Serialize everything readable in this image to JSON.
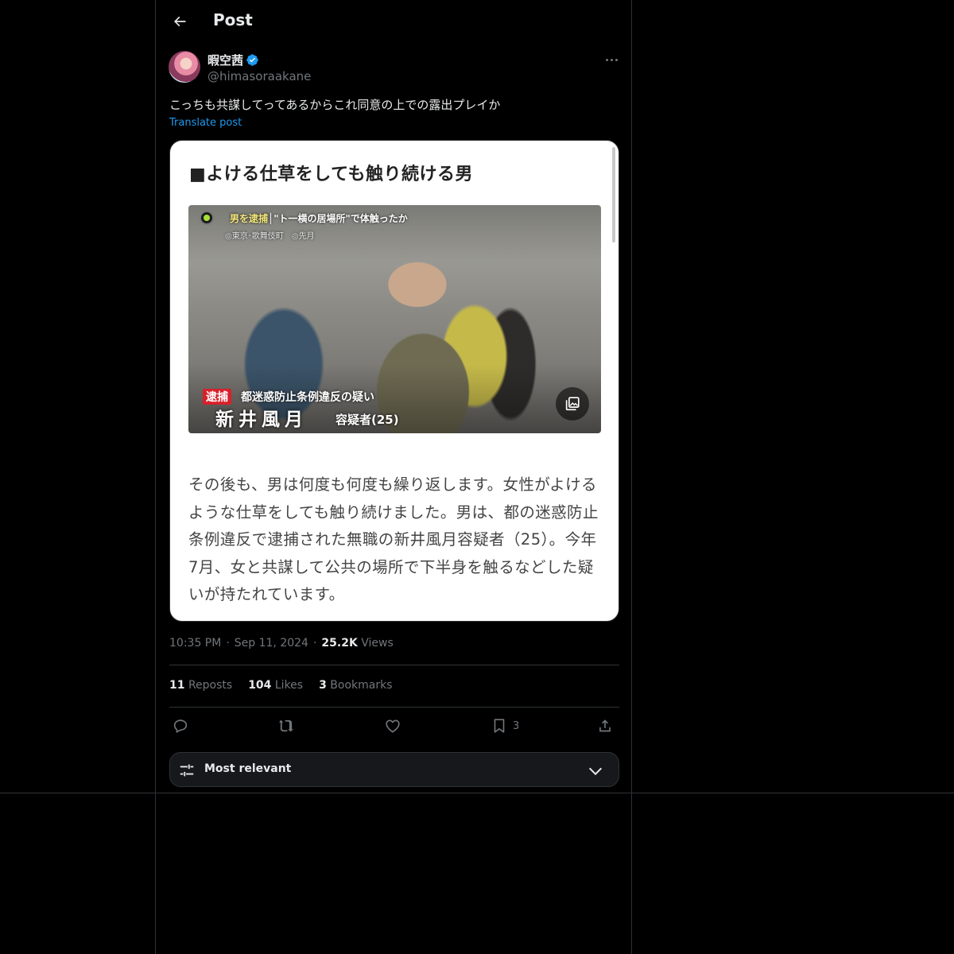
{
  "header": {
    "title": "Post"
  },
  "author": {
    "display_name": "暇空茜",
    "handle": "@himasoraakane",
    "verified": true
  },
  "post": {
    "text": "こっちも共謀してってあるからこれ同意の上での露出プレイか",
    "translate_label": "Translate post",
    "time": "10:35 PM",
    "date": "Sep 11, 2024",
    "views_count": "25.2K",
    "views_label": "Views",
    "separator": "·"
  },
  "media": {
    "heading": "■よける仕草をしても触り続ける男",
    "photo": {
      "caption_tag": "男を逮捕",
      "caption_top": "│\"ト一横の居場所\"で体触ったか",
      "caption_sub": "◎東京･歌舞伎町　◎先月",
      "arrest_badge": "逮捕",
      "arrest_charge": "都迷惑防止条例違反の疑い",
      "suspect_name": "新井風月",
      "suspect_title": "容疑者(25)"
    },
    "body": "その後も、男は何度も何度も繰り返します。女性がよけるような仕草をしても触り続けました。男は、都の迷惑防止条例違反で逮捕された無職の新井風月容疑者（25）。今年7月、女と共謀して公共の場所で下半身を触るなどした疑いが持たれています。"
  },
  "stats": {
    "reposts_count": "11",
    "reposts_label": "Reposts",
    "likes_count": "104",
    "likes_label": "Likes",
    "bookmarks_count": "3",
    "bookmarks_label": "Bookmarks"
  },
  "actions": {
    "bookmark_count": "3"
  },
  "sort": {
    "label": "Most relevant"
  },
  "colors": {
    "accent": "#1d9bf0",
    "background": "#000000",
    "secondary_text": "#71767b",
    "border": "#2f3336"
  }
}
